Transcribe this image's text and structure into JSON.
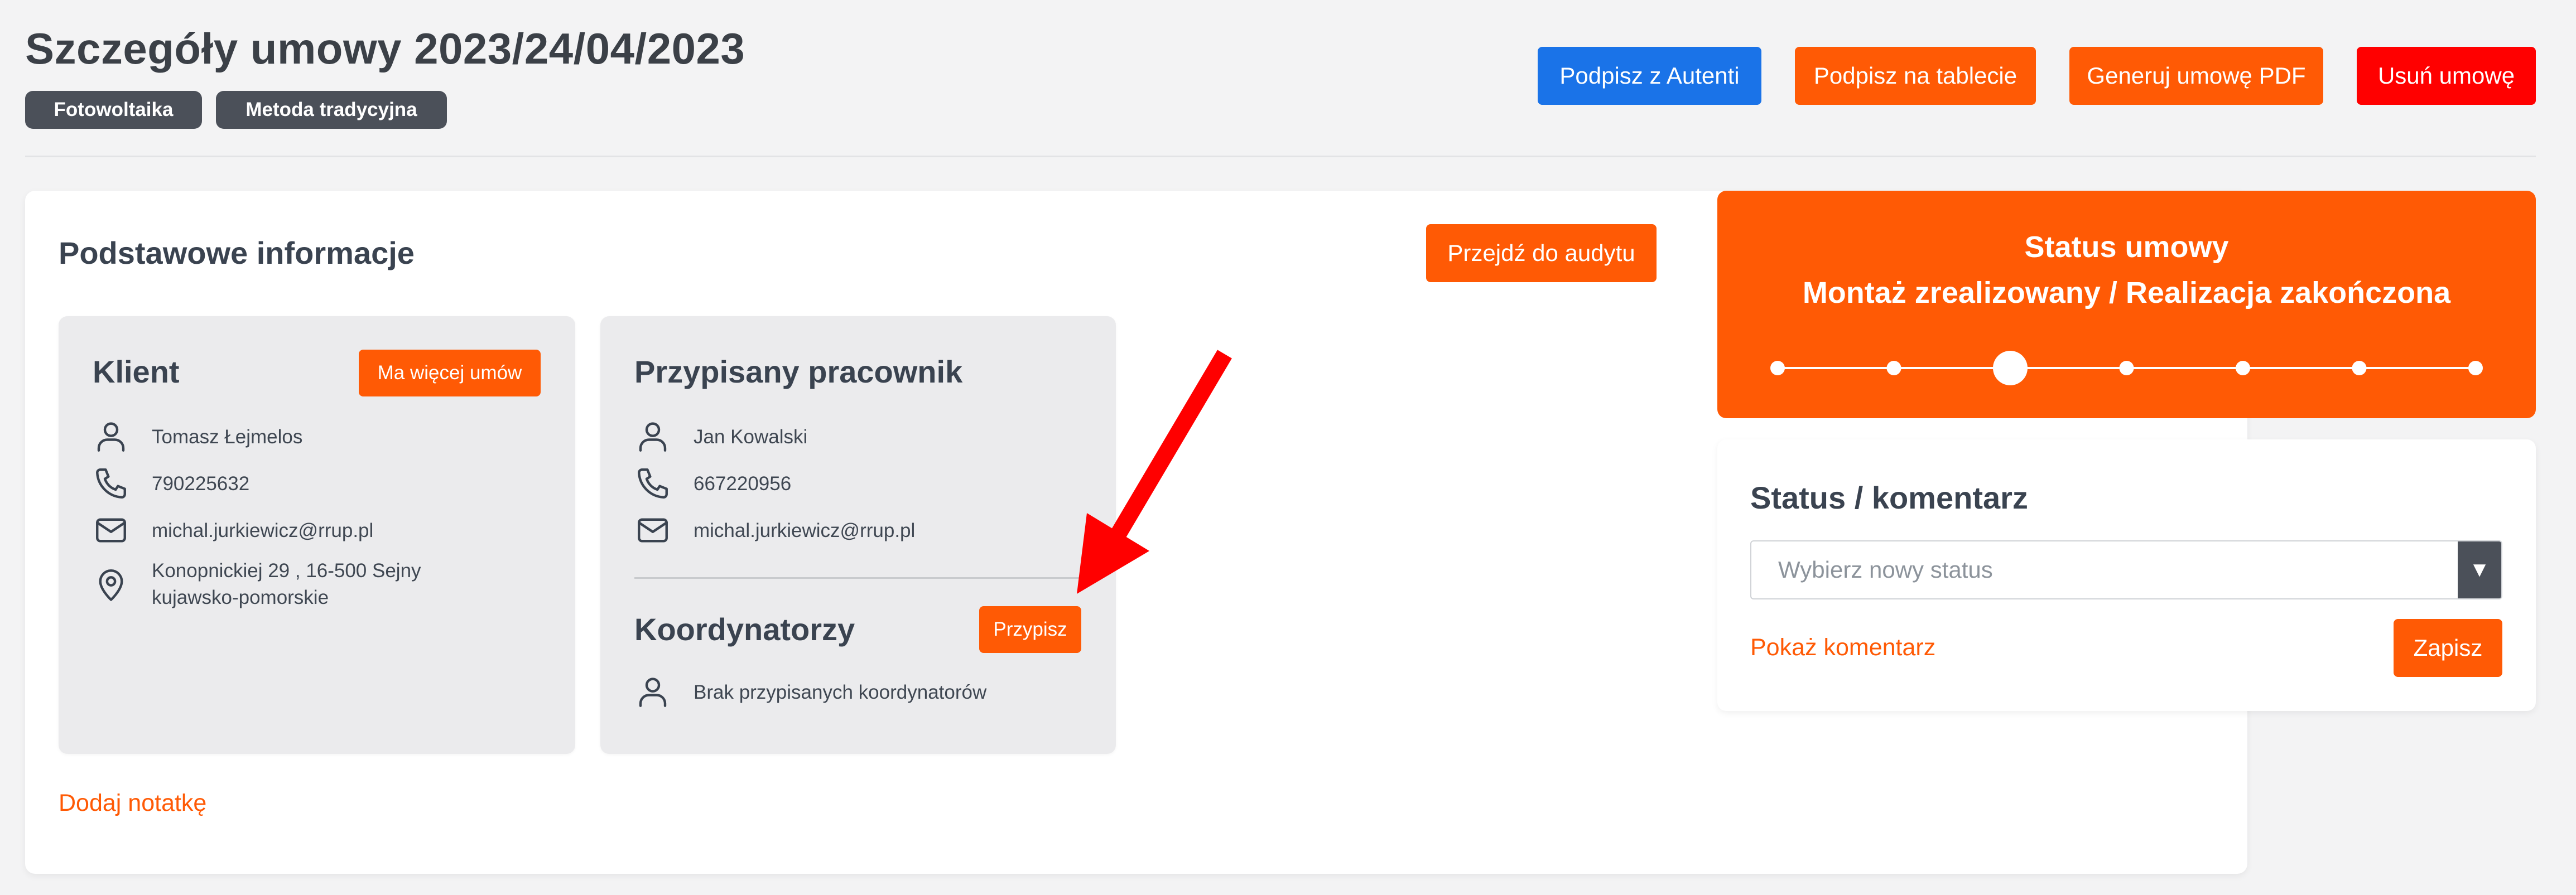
{
  "header": {
    "title": "Szczegóły umowy 2023/24/04/2023",
    "tags": [
      "Fotowoltaika",
      "Metoda tradycyjna"
    ],
    "buttons": {
      "sign_autenti": "Podpisz z Autenti",
      "sign_tablet": "Podpisz na tablecie",
      "generate_pdf": "Generuj umowę PDF",
      "delete": "Usuń umowę"
    }
  },
  "basic_info": {
    "title": "Podstawowe informacje",
    "audit_button": "Przejdź do audytu",
    "add_note": "Dodaj notatkę",
    "client": {
      "title": "Klient",
      "more_contracts_button": "Ma więcej umów",
      "name": "Tomasz Łejmelos",
      "phone": "790225632",
      "email": "michal.jurkiewicz@rrup.pl",
      "address_line1": "Konopnickiej 29 , 16-500 Sejny",
      "address_line2": "kujawsko-pomorskie"
    },
    "employee": {
      "title": "Przypisany pracownik",
      "name": "Jan Kowalski",
      "phone": "667220956",
      "email": "michal.jurkiewicz@rrup.pl"
    },
    "coordinators": {
      "title": "Koordynatorzy",
      "assign_button": "Przypisz",
      "empty_text": "Brak przypisanych koordynatorów"
    }
  },
  "status": {
    "title": "Status umowy",
    "current": "Montaż zrealizowany / Realizacja zakończona",
    "steps_total": 7,
    "current_step": 3
  },
  "comment": {
    "title": "Status / komentarz",
    "select_placeholder": "Wybierz nowy status",
    "show_comment": "Pokaż komentarz",
    "save_button": "Zapisz"
  },
  "colors": {
    "accent": "#ff5a05",
    "blue": "#1a73e8",
    "red": "#ff0000",
    "tag_bg": "#4b5059",
    "annotation_arrow": "#ff0000"
  },
  "icons": {
    "person": "person-icon",
    "phone": "phone-icon",
    "mail": "mail-icon",
    "location": "location-pin-icon",
    "chevron": "chevron-down-icon",
    "arrow": "red-arrow-annotation"
  }
}
